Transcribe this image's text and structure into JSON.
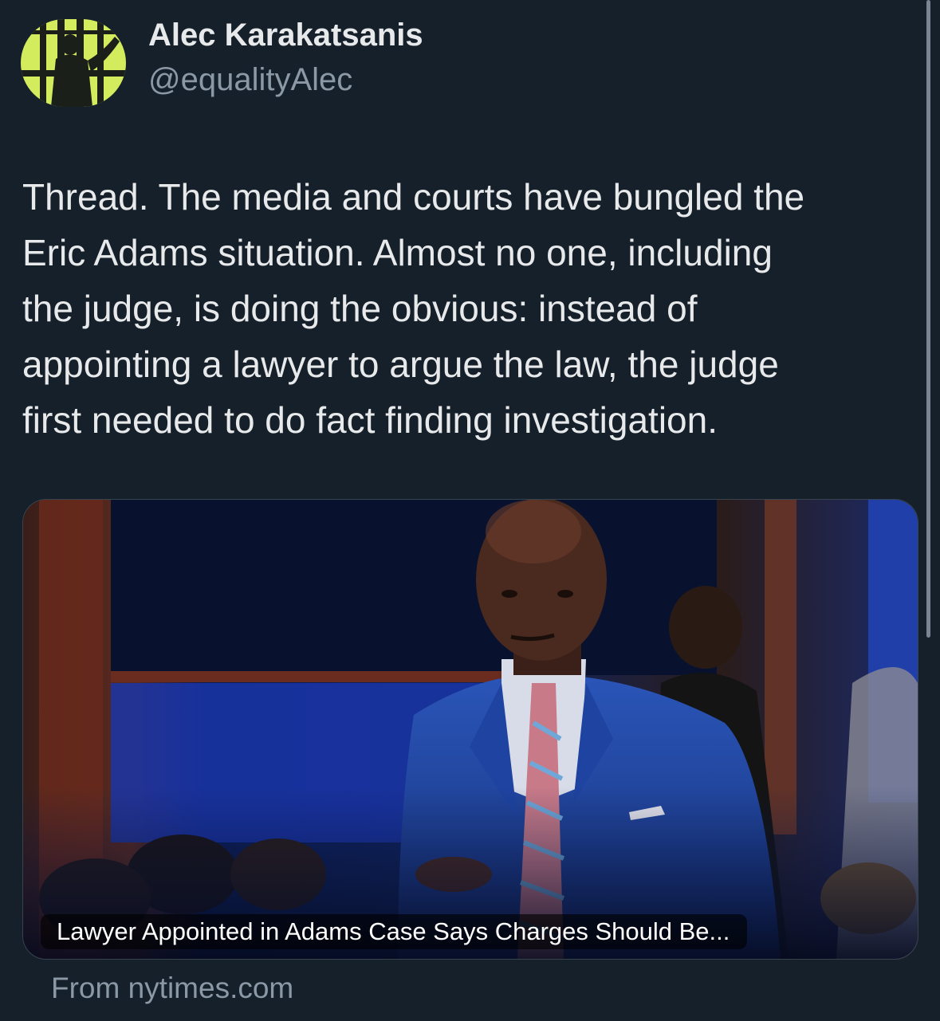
{
  "tweet": {
    "author": {
      "display_name": "Alec Karakatsanis",
      "handle": "@equalityAlec",
      "avatar_icon": "prison-bars-avatar-icon"
    },
    "text": "Thread. The media and courts have bungled the\nEric Adams situation. Almost no one, including\nthe judge, is doing the obvious: instead of\nappointing a lawyer to argue the law, the judge\nfirst needed to do fact finding investigation.",
    "card": {
      "title": "Lawyer Appointed in Adams Case Says Charges Should Be...",
      "source": "From nytimes.com"
    }
  },
  "colors": {
    "background": "#15202b",
    "text_primary": "#e7e9ea",
    "text_secondary": "#8b98a5",
    "avatar_accent": "#d3ec5e"
  }
}
